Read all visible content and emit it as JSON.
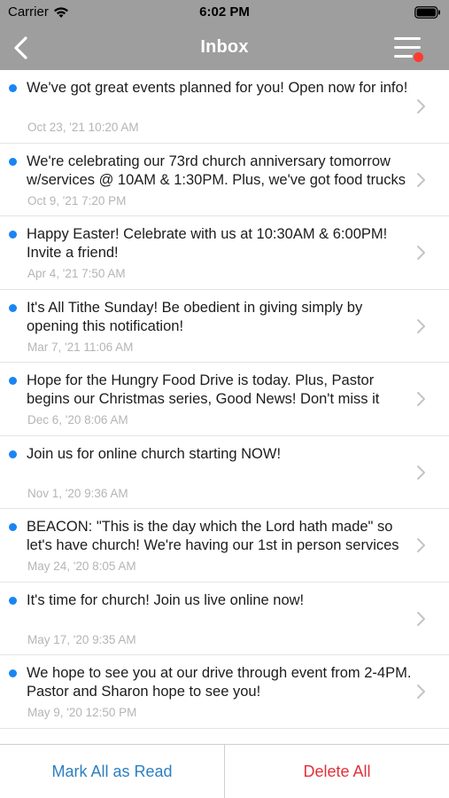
{
  "status_bar": {
    "carrier": "Carrier",
    "time": "6:02 PM"
  },
  "nav": {
    "title": "Inbox"
  },
  "messages": [
    {
      "text": "We've got great events planned for you! Open now for info!",
      "date": "Oct 23, '21 10:20 AM"
    },
    {
      "text": "We're celebrating our 73rd church anniversary tomorrow w/services @ 10AM & 1:30PM. Plus, we've got food trucks",
      "date": "Oct 9, '21 7:20 PM"
    },
    {
      "text": "Happy Easter! Celebrate with us at 10:30AM & 6:00PM! Invite a friend!",
      "date": "Apr 4, '21 7:50 AM"
    },
    {
      "text": "It's All Tithe Sunday! Be obedient in giving simply by opening this notification!",
      "date": "Mar 7, '21 11:06 AM"
    },
    {
      "text": "Hope for the Hungry Food Drive is today. Plus, Pastor begins our Christmas series, Good News! Don't miss it",
      "date": "Dec 6, '20 8:06 AM"
    },
    {
      "text": "Join us for online church starting NOW!",
      "date": "Nov 1, '20 9:36 AM"
    },
    {
      "text": "BEACON: \"This is the day which the Lord hath made\" so let's have church! We're having our 1st in person services",
      "date": "May 24, '20 8:05 AM"
    },
    {
      "text": "It's time for church! Join us live online now!",
      "date": "May 17, '20 9:35 AM"
    },
    {
      "text": "We hope to see you at our drive through event from 2-4PM. Pastor and Sharon hope to see you!",
      "date": "May 9, '20 12:50 PM"
    }
  ],
  "footer": {
    "mark_all_read": "Mark All as Read",
    "delete_all": "Delete All"
  },
  "colors": {
    "nav_bg": "#9e9e9e",
    "unread_dot": "#1a85f2",
    "menu_badge": "#ff3b30",
    "mark_read_text": "#2d7fc1",
    "delete_text": "#e0323a"
  },
  "icons": {
    "back": "chevron-left-icon",
    "menu": "hamburger-menu-icon",
    "row_disclosure": "chevron-right-icon",
    "signal": "wifi-icon",
    "battery": "battery-icon"
  }
}
